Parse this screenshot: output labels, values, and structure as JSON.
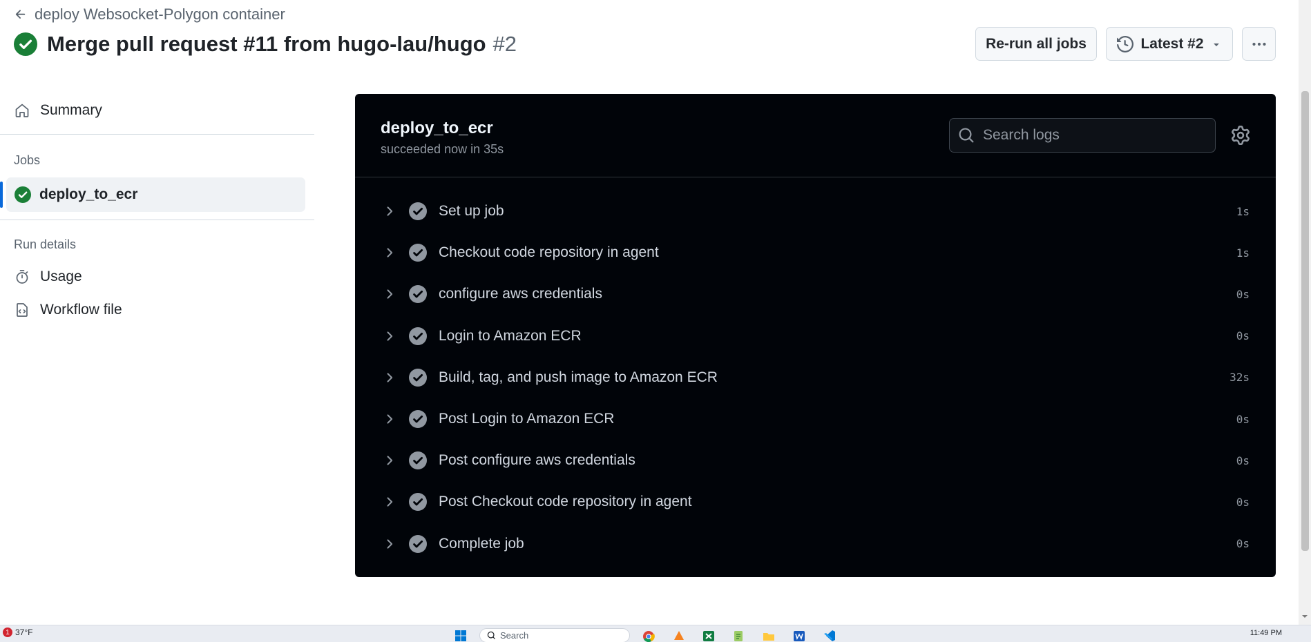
{
  "header": {
    "back_label": "deploy Websocket-Polygon container",
    "title": "Merge pull request #11 from hugo-lau/hugo",
    "run_number": "#2",
    "rerun_label": "Re-run all jobs",
    "latest_label": "Latest #2"
  },
  "sidebar": {
    "summary_label": "Summary",
    "jobs_heading": "Jobs",
    "job_label": "deploy_to_ecr",
    "run_details_heading": "Run details",
    "usage_label": "Usage",
    "workflow_file_label": "Workflow file"
  },
  "panel": {
    "job_title": "deploy_to_ecr",
    "job_status": "succeeded now in 35s",
    "search_placeholder": "Search logs",
    "steps": [
      {
        "name": "Set up job",
        "duration": "1s"
      },
      {
        "name": "Checkout code repository in agent",
        "duration": "1s"
      },
      {
        "name": "configure aws credentials",
        "duration": "0s"
      },
      {
        "name": "Login to Amazon ECR",
        "duration": "0s"
      },
      {
        "name": "Build, tag, and push image to Amazon ECR",
        "duration": "32s"
      },
      {
        "name": "Post Login to Amazon ECR",
        "duration": "0s"
      },
      {
        "name": "Post configure aws credentials",
        "duration": "0s"
      },
      {
        "name": "Post Checkout code repository in agent",
        "duration": "0s"
      },
      {
        "name": "Complete job",
        "duration": "0s"
      }
    ]
  },
  "taskbar": {
    "notification_count": "1",
    "weather": "37°F",
    "search_label": "Search",
    "time": "11:49 PM"
  },
  "colors": {
    "success": "#1a7f37",
    "panel_bg": "#010409",
    "accent": "#0969da"
  }
}
